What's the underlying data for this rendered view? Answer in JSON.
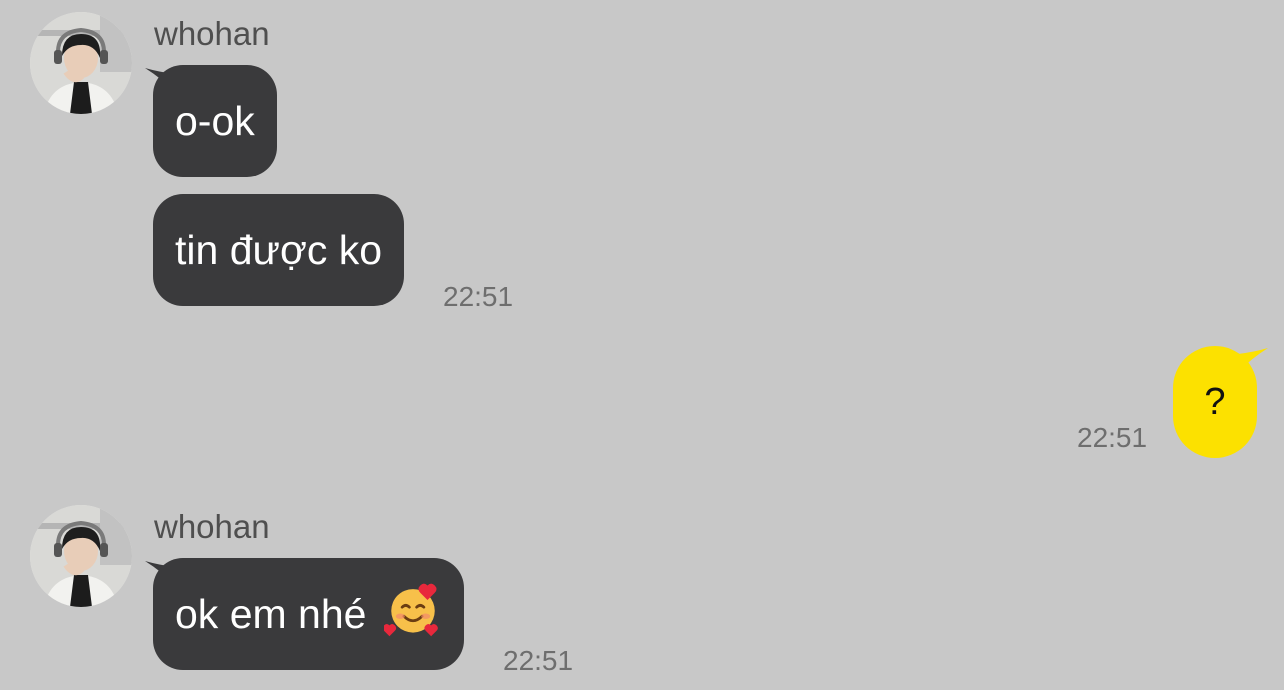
{
  "messages": [
    {
      "sender": "whohan",
      "direction": "incoming",
      "bubbles": [
        "o-ok",
        "tin được ko"
      ],
      "time": "22:51"
    },
    {
      "direction": "outgoing",
      "bubbles": [
        "?"
      ],
      "time": "22:51"
    },
    {
      "sender": "whohan",
      "direction": "incoming",
      "bubbles": [
        "ok em nhé"
      ],
      "emoji": "smiling-face-with-hearts",
      "time": "22:51"
    }
  ],
  "colors": {
    "background": "#c8c8c8",
    "incoming_bubble": "#3a3a3c",
    "outgoing_bubble": "#fce100",
    "timestamp": "#6e6e6e"
  }
}
